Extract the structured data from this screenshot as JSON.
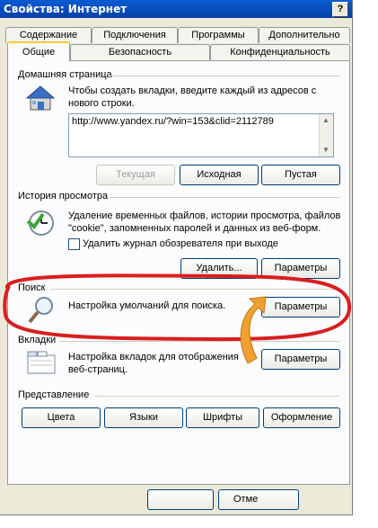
{
  "window": {
    "title": "Свойства: Интернет",
    "help": "?"
  },
  "tabs_top": [
    "Содержание",
    "Подключения",
    "Программы",
    "Дополнительно"
  ],
  "tabs_bottom": [
    "Общие",
    "Безопасность",
    "Конфиденциальность"
  ],
  "home": {
    "heading": "Домашняя страница",
    "desc_line1": "Чтобы создать вкладки, введите каждый из адресов с",
    "desc_line2": "нового строки.",
    "url": "http://www.yandex.ru/?win=153&clid=2112789",
    "btn_current": "Текущая",
    "btn_default": "Исходная",
    "btn_blank": "Пустая"
  },
  "history": {
    "heading": "История просмотра",
    "desc_line1": "Удаление временных файлов, истории просмотра, файлов",
    "desc_line2": "\"cookie\", запомненных паролей и данных из веб-форм.",
    "checkbox_label": "Удалить журнал обозревателя при выходе",
    "btn_delete": "Удалить...",
    "btn_params": "Параметры"
  },
  "search": {
    "heading": "Поиск",
    "desc": "Настройка умолчаний для поиска.",
    "btn_params": "Параметры"
  },
  "tabs_section": {
    "heading": "Вкладки",
    "desc_line1": "Настройка вкладок для отображения",
    "desc_line2": "веб-страниц.",
    "btn_params": "Параметры"
  },
  "appearance": {
    "heading": "Представление",
    "btn_colors": "Цвета",
    "btn_languages": "Языки",
    "btn_fonts": "Шрифты",
    "btn_design": "Оформление"
  },
  "footer": {
    "btn_cancel_partial": "Отме"
  },
  "colors": {
    "highlight": "#d81f1f",
    "arrow": "#f0a030",
    "titlebar": "#0a5bd3"
  }
}
